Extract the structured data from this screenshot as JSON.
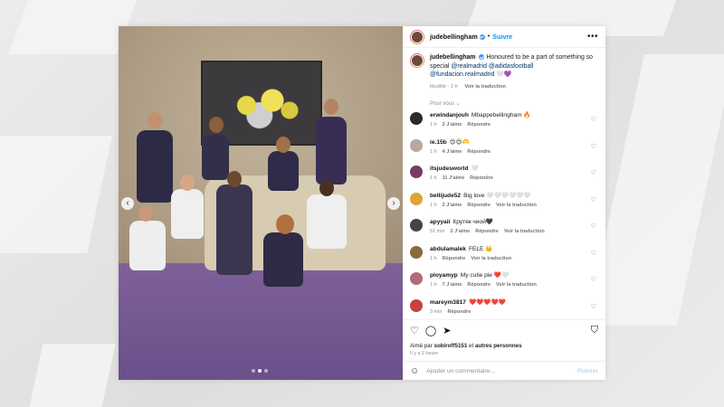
{
  "post": {
    "username": "judebellingham",
    "follow_label": "Suivre",
    "more_label": "•••",
    "caption": {
      "username": "judebellingham",
      "text_before": "Honoured to be a part of something so special",
      "tags": "@realmadrid @adidasfootball @fundacion.realmadrid",
      "emoji": "🤍💜",
      "meta_time": "Modifié · 1 h",
      "meta_translate": "Voir la traduction"
    },
    "sort_label": "Pour vous ⌄",
    "comments": [
      {
        "user": "erwindanjouh",
        "text": "Mbappebellingham 🔥",
        "time": "1 h",
        "likes": "2 J’aime",
        "reply": "Répondre",
        "translate": "",
        "avatar_color": "#2e2b28"
      },
      {
        "user": "ie.15b",
        "text": "😍😍🫶",
        "time": "1 h",
        "likes": "4 J’aime",
        "reply": "Répondre",
        "translate": "",
        "avatar_color": "#b8a9a0"
      },
      {
        "user": "itsjudesworld",
        "text": "🤍",
        "time": "1 h",
        "likes": "11 J’aime",
        "reply": "Répondre",
        "translate": "",
        "avatar_color": "#7a3b63"
      },
      {
        "user": "bellijude52",
        "text": "Big love 🤍🤍🤍🤍🤍🤍",
        "time": "1 h",
        "likes": "2 J’aime",
        "reply": "Répondre",
        "translate": "Voir la traduction",
        "avatar_color": "#e0a33a"
      },
      {
        "user": "apyyaii",
        "text": "Крутяк чиой🖤",
        "time": "51 min",
        "likes": "2 J’aime",
        "reply": "Répondre",
        "translate": "Voir la traduction",
        "avatar_color": "#444444"
      },
      {
        "user": "abdulamalek",
        "text": "FELE 👑",
        "time": "1 h",
        "likes": "",
        "reply": "Répondre",
        "translate": "Voir la traduction",
        "avatar_color": "#8a6a3e"
      },
      {
        "user": "ployamyp",
        "text": "My cutie pie ❤️🤍",
        "time": "1 h",
        "likes": "7 J’aime",
        "reply": "Répondre",
        "translate": "Voir la traduction",
        "avatar_color": "#b06a7a"
      },
      {
        "user": "mareym3817",
        "text": "❤️❤️❤️❤️❤️",
        "time": "3 min",
        "likes": "",
        "reply": "Répondre",
        "translate": "",
        "avatar_color": "#c94040"
      }
    ],
    "liked_by_prefix": "Aimé par",
    "liked_by_user": "sobiroff5151",
    "liked_by_suffix": "et",
    "liked_by_others": "autres personnes",
    "time_ago": "Il y a 1 heure",
    "comment_placeholder": "Ajouter un commentaire…",
    "publish_label": "Publier",
    "carousel": {
      "slides": 3,
      "current": 1
    }
  },
  "icons": {
    "like": "heart-icon",
    "comment": "comment-icon",
    "share": "share-icon",
    "save": "bookmark-icon",
    "emoji": "emoji-icon"
  },
  "colors": {
    "link": "#0095f6",
    "tag": "#00376b",
    "verified": "#3897f0"
  }
}
